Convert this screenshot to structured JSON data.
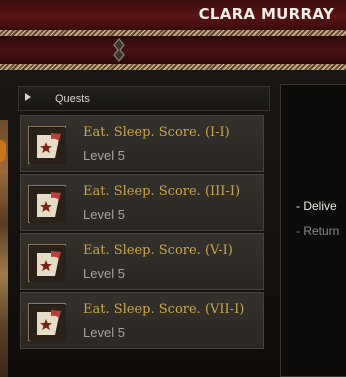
{
  "header": {
    "player_name": "CLARA MURRAY"
  },
  "quests_panel": {
    "title": "Quests",
    "items": [
      {
        "name": "Eat. Sleep. Score. (I-I)",
        "level": "Level 5",
        "icon": "scroll-star-icon"
      },
      {
        "name": "Eat. Sleep. Score. (III-I)",
        "level": "Level 5",
        "icon": "scroll-star-icon"
      },
      {
        "name": "Eat. Sleep. Score. (V-I)",
        "level": "Level 5",
        "icon": "scroll-star-icon"
      },
      {
        "name": "Eat. Sleep. Score. (VII-I)",
        "level": "Level 5",
        "icon": "scroll-star-icon"
      }
    ]
  },
  "objectives": {
    "deliver": "- Delive",
    "return": "- Return"
  },
  "colors": {
    "header_red": "#5a1414",
    "quest_gold": "#c9a84a",
    "level_gray": "#a9a49c"
  }
}
